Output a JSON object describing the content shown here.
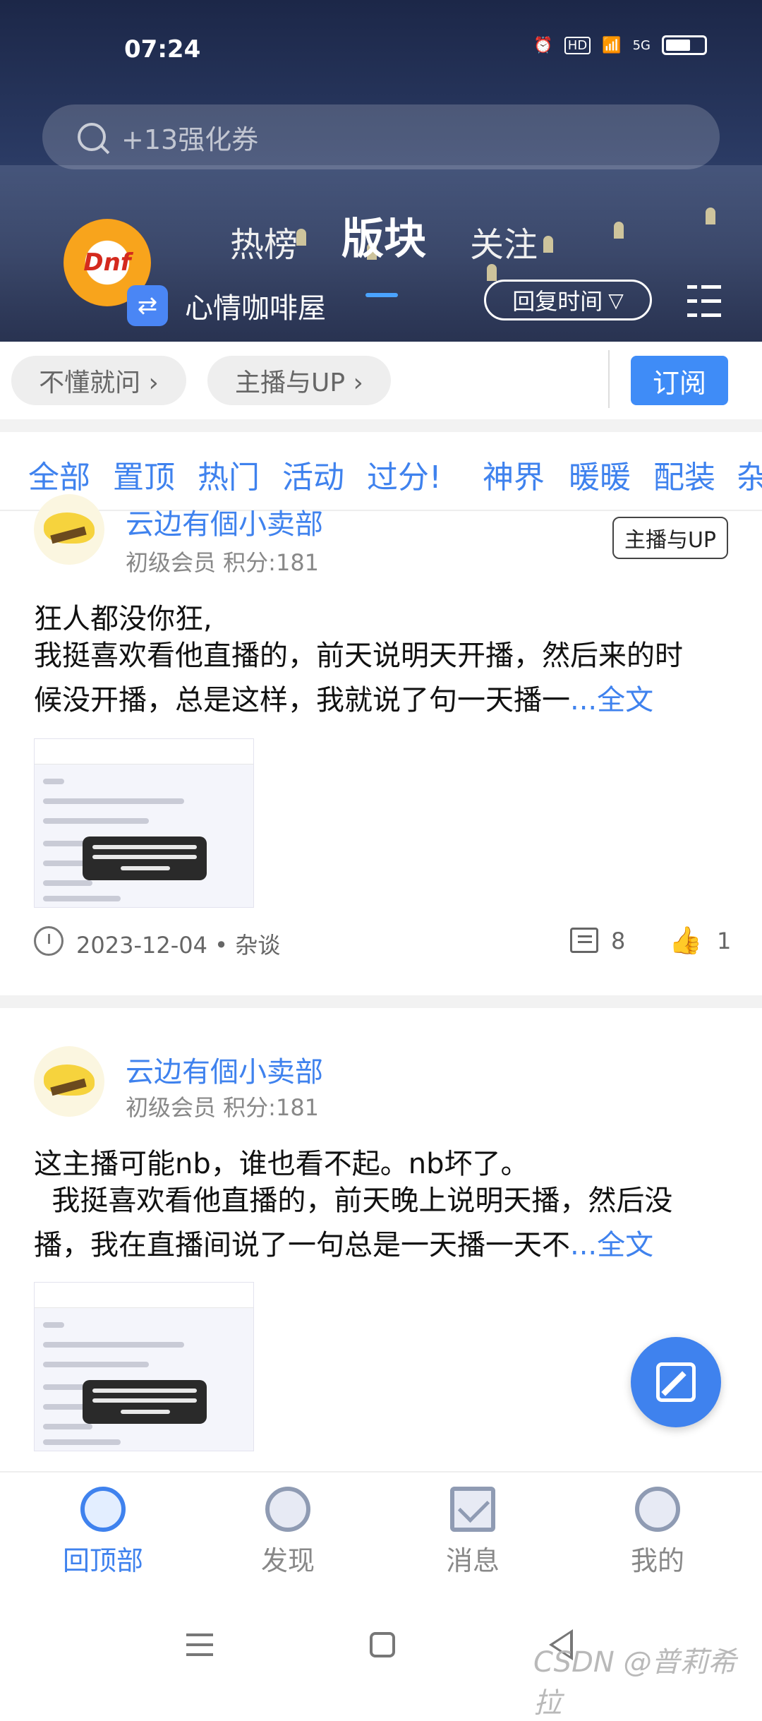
{
  "status_bar": {
    "time": "07:24",
    "hd": "HD",
    "network": "5G"
  },
  "search": {
    "placeholder": "+13强化券"
  },
  "top_tabs": [
    "热榜",
    "版块",
    "关注"
  ],
  "active_tab": "版块",
  "board": {
    "logo": "Dnf",
    "name": "心情咖啡屋",
    "sort_label": "回复时间"
  },
  "tags": {
    "tag1": "不懂就问 ›",
    "tag2": "主播与UP ›",
    "subscribe": "订阅"
  },
  "categories": [
    "全部",
    "置顶",
    "热门",
    "活动",
    "过分!",
    "神界",
    "暖暖",
    "配装",
    "杂"
  ],
  "posts": [
    {
      "author": "云边有個小卖部",
      "meta": "初级会员 积分:181",
      "tag": "主播与UP",
      "title": "狂人都没你狂,",
      "line1": "我挺喜欢看他直播的，前天说明天开播，然后来的时",
      "line2": "候没开播，总是这样，我就说了句一天播一",
      "more": "...全文",
      "date": "2023-12-04 • 杂谈",
      "comments": "8",
      "likes": "1"
    },
    {
      "author": "云边有個小卖部",
      "meta": "初级会员 积分:181",
      "title": "这主播可能nb，谁也看不起。nb坏了。",
      "line1": "  我挺喜欢看他直播的，前天晚上说明天播，然后没",
      "line2": "播，我在直播间说了一句总是一天播一天不",
      "more": "...全文"
    }
  ],
  "bottom_nav": [
    "回顶部",
    "发现",
    "消息",
    "我的"
  ],
  "watermark": "CSDN @普莉希拉",
  "colors": {
    "accent": "#3f82ee",
    "subscribe_bg": "#3f8cf7",
    "header_bg": "#2a3a63"
  }
}
